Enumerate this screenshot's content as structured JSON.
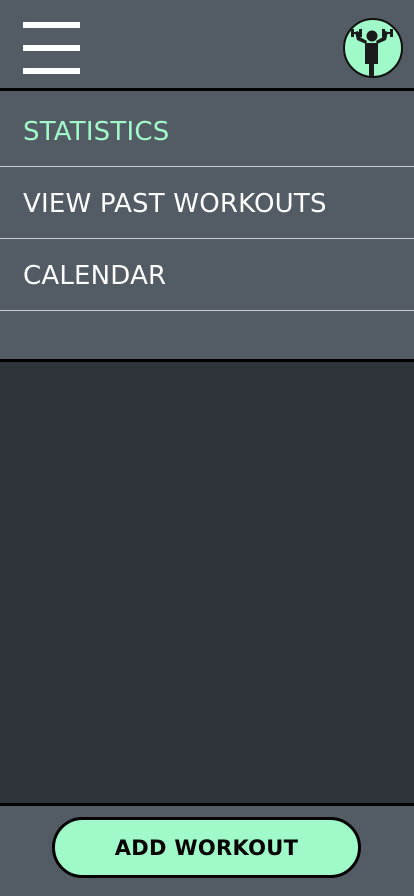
{
  "header": {
    "menu_icon": "hamburger-menu-icon",
    "avatar_icon": "weightlifter-avatar-icon"
  },
  "menu": {
    "items": [
      {
        "label": "STATISTICS",
        "active": true
      },
      {
        "label": "VIEW PAST WORKOUTS",
        "active": false
      },
      {
        "label": "CALENDAR",
        "active": false
      }
    ]
  },
  "footer": {
    "add_workout_label": "ADD WORKOUT"
  },
  "colors": {
    "accent": "#a0f9c8",
    "panel": "#535c64",
    "background": "#2f333a",
    "text": "#ffffff",
    "border": "#000000"
  }
}
